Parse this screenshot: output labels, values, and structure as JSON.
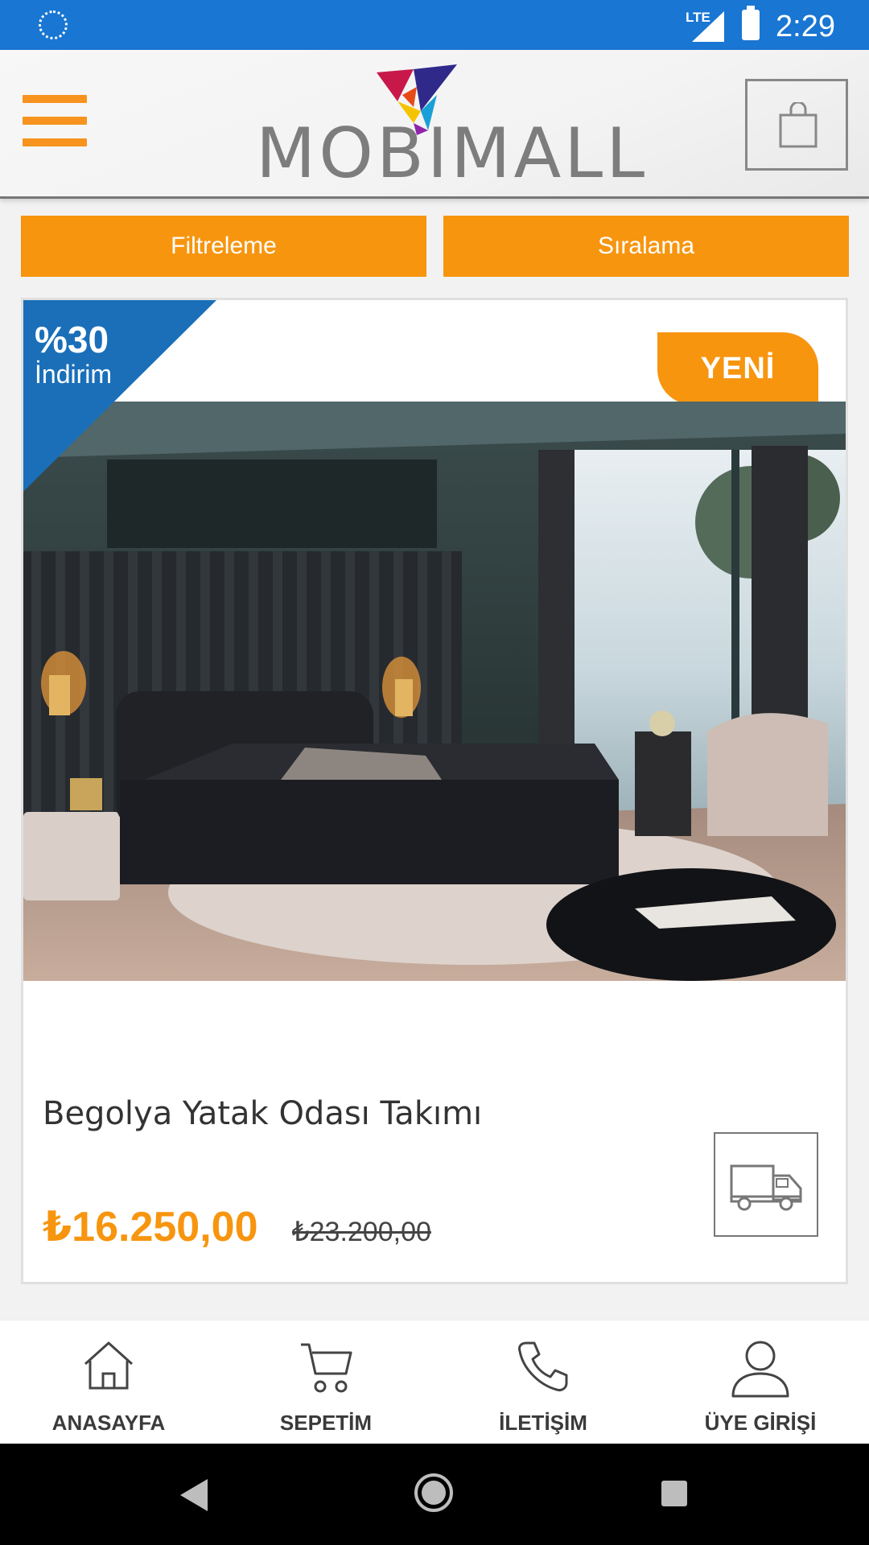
{
  "status_bar": {
    "network": "LTE",
    "time": "2:29"
  },
  "header": {
    "logo_text": "MOBIMALL"
  },
  "actions": {
    "filter_label": "Filtreleme",
    "sort_label": "Sıralama"
  },
  "product": {
    "discount_percent": "%30",
    "discount_label": "İndirim",
    "badge": "YENİ",
    "name": "Begolya Yatak Odası Takımı",
    "price": "₺16.250,00",
    "old_price": "₺23.200,00",
    "shipping_icon": "truck-icon"
  },
  "bottom_nav": [
    {
      "label": "ANASAYFA",
      "icon": "home-icon"
    },
    {
      "label": "SEPETİM",
      "icon": "cart-icon"
    },
    {
      "label": "İLETİŞİM",
      "icon": "phone-icon"
    },
    {
      "label": "ÜYE GİRİŞİ",
      "icon": "user-icon"
    }
  ],
  "colors": {
    "accent": "#f7950f",
    "status_bar": "#1976d2",
    "discount": "#1a6fb8"
  }
}
